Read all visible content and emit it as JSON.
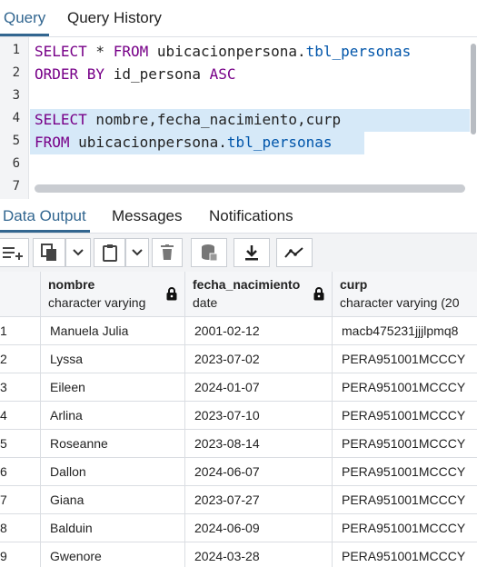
{
  "top_tabs": [
    "Query",
    "Query History"
  ],
  "editor": {
    "line_numbers": [
      "1",
      "2",
      "3",
      "4",
      "5",
      "6",
      "7"
    ],
    "line1": {
      "kw1": "SELECT",
      "t1": " * ",
      "kw2": "FROM",
      "t2": " ubicacionpersona.",
      "tbl": "tbl_personas"
    },
    "line2": {
      "kw1": "ORDER BY",
      "t1": " id_persona ",
      "kw2": "ASC"
    },
    "line4": {
      "kw1": "SELECT",
      "t1": " nombre,fecha_nacimiento,curp"
    },
    "line5": {
      "kw1": "FROM",
      "t1": " ubicacionpersona.",
      "tbl": "tbl_personas"
    }
  },
  "output_tabs": [
    "Data Output",
    "Messages",
    "Notifications"
  ],
  "toolbar": {
    "icons": [
      "add-row-icon",
      "copy-icon",
      "chevron-down-icon",
      "paste-icon",
      "chevron-down-icon",
      "delete-icon",
      "save-data-icon",
      "download-icon",
      "graph-icon"
    ]
  },
  "grid": {
    "columns": [
      {
        "name": "nombre",
        "type": "character varying"
      },
      {
        "name": "fecha_nacimiento",
        "type": "date"
      },
      {
        "name": "curp",
        "type": "character varying (20"
      }
    ],
    "rows": [
      {
        "n": "1",
        "nombre": "Manuela Julia",
        "fecha": "2001-02-12",
        "curp": "macb475231jjjlpmq8"
      },
      {
        "n": "2",
        "nombre": "Lyssa",
        "fecha": "2023-07-02",
        "curp": "PERA951001MCCCY"
      },
      {
        "n": "3",
        "nombre": "Eileen",
        "fecha": "2024-01-07",
        "curp": "PERA951001MCCCY"
      },
      {
        "n": "4",
        "nombre": "Arlina",
        "fecha": "2023-07-10",
        "curp": "PERA951001MCCCY"
      },
      {
        "n": "5",
        "nombre": "Roseanne",
        "fecha": "2023-08-14",
        "curp": "PERA951001MCCCY"
      },
      {
        "n": "6",
        "nombre": "Dallon",
        "fecha": "2024-06-07",
        "curp": "PERA951001MCCCY"
      },
      {
        "n": "7",
        "nombre": "Giana",
        "fecha": "2023-07-27",
        "curp": "PERA951001MCCCY"
      },
      {
        "n": "8",
        "nombre": "Balduin",
        "fecha": "2024-06-09",
        "curp": "PERA951001MCCCY"
      },
      {
        "n": "9",
        "nombre": "Gwenore",
        "fecha": "2024-03-28",
        "curp": "PERA951001MCCCY"
      }
    ]
  },
  "colors": {
    "accent": "#326690",
    "keyword": "#770088",
    "table": "#0055aa",
    "highlight": "#d6e9f8"
  }
}
